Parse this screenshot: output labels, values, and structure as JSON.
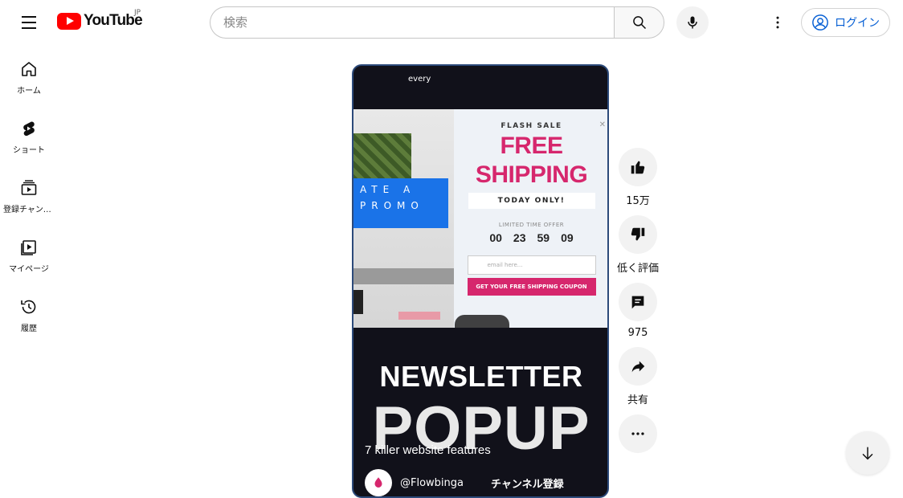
{
  "header": {
    "logo_text": "YouTube",
    "region": "JP",
    "search_placeholder": "検索",
    "login_label": "ログイン"
  },
  "sidebar": {
    "items": [
      {
        "label": "ホーム",
        "icon": "home-icon"
      },
      {
        "label": "ショート",
        "icon": "shorts-icon"
      },
      {
        "label": "登録チャンネル",
        "icon": "subscriptions-icon"
      },
      {
        "label": "マイページ",
        "icon": "library-icon"
      },
      {
        "label": "履歴",
        "icon": "history-icon"
      }
    ]
  },
  "video": {
    "channel_top": "every",
    "promo": {
      "left_text": "ATE A PROMO",
      "flash_sale": "FLASH SALE",
      "free_line1": "FREE",
      "free_line2": "SHIPPING",
      "today_only": "TODAY ONLY!",
      "limited": "LIMITED TIME OFFER",
      "countdown": [
        "00",
        "23",
        "59",
        "09"
      ],
      "email_placeholder": "email here...",
      "coupon_label": "GET YOUR FREE SHIPPING COUPON"
    },
    "headline1": "NEWSLETTER",
    "headline2": "POPUP",
    "title": "7 killer website features",
    "channel_name": "@Flowbinga",
    "subscribe_label": "チャンネル登録"
  },
  "actions": {
    "like_count": "15万",
    "dislike_label": "低く評価",
    "comment_count": "975",
    "share_label": "共有"
  },
  "colors": {
    "brand_red": "#ff0000",
    "link_blue": "#065fd4",
    "promo_pink": "#d6276d"
  }
}
